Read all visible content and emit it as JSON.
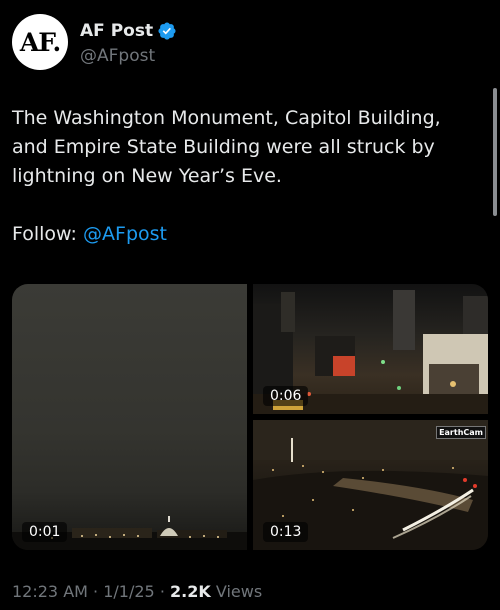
{
  "author": {
    "avatar_text": "AF.",
    "name": "AF Post",
    "handle": "@AFpost",
    "verified_color": "#1d9bf0"
  },
  "tweet": {
    "text": "The Washington Monument, Capitol Building, and Empire State Building were all struck by lightning on New Year’s Eve.",
    "follow_label": "Follow:",
    "follow_mention": "@AFpost"
  },
  "media": [
    {
      "duration": "0:01"
    },
    {
      "duration": "0:06"
    },
    {
      "duration": "0:13",
      "badge": "EarthCam"
    }
  ],
  "meta": {
    "time": "12:23 AM",
    "separator": "·",
    "date": "1/1/25",
    "views_count": "2.2K",
    "views_label": "Views"
  },
  "colors": {
    "background": "#000000",
    "text": "#e7e9ea",
    "muted": "#71767b",
    "link": "#1d9bf0"
  }
}
